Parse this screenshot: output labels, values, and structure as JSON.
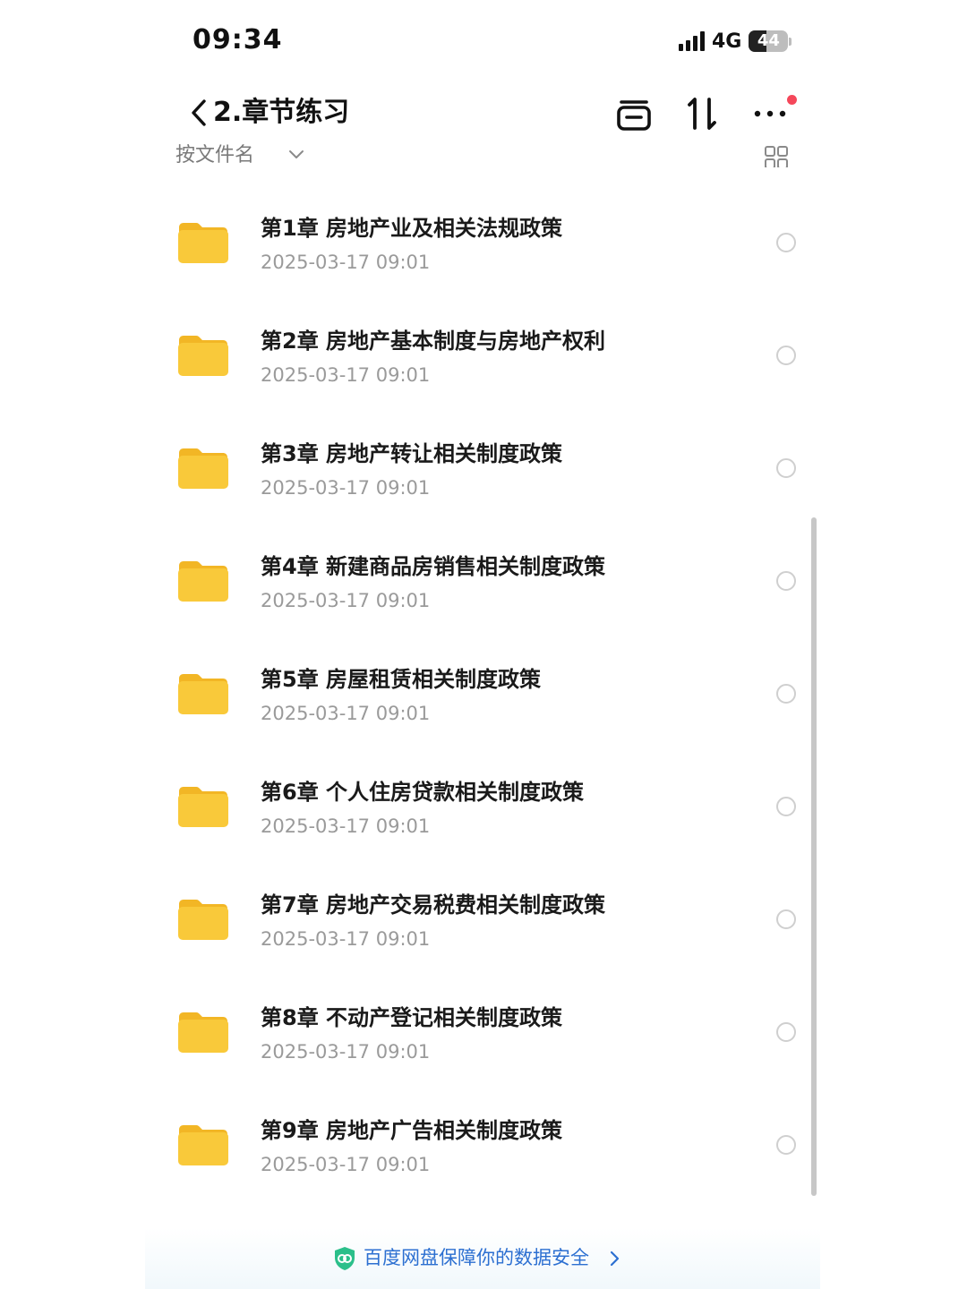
{
  "status_bar": {
    "time": "09:34",
    "network": "4G",
    "battery_level": "44",
    "battery_fraction": 0.44,
    "icons": [
      "signal-icon",
      "battery-icon"
    ]
  },
  "nav": {
    "title": "2.章节练习",
    "icons": [
      "back-chevron-icon",
      "dropbox-icon",
      "sort-icon",
      "more-icon"
    ],
    "notification_dot_color": "#f5475a"
  },
  "toolbar": {
    "sort_label": "按文件名",
    "icons": [
      "chevron-down-icon",
      "grid-view-icon"
    ]
  },
  "files": [
    {
      "name": "第1章 房地产业及相关法规政策",
      "date": "2025-03-17 09:01"
    },
    {
      "name": "第2章 房地产基本制度与房地产权利",
      "date": "2025-03-17 09:01"
    },
    {
      "name": "第3章 房地产转让相关制度政策",
      "date": "2025-03-17 09:01"
    },
    {
      "name": "第4章 新建商品房销售相关制度政策",
      "date": "2025-03-17 09:01"
    },
    {
      "name": "第5章 房屋租赁相关制度政策",
      "date": "2025-03-17 09:01"
    },
    {
      "name": "第6章 个人住房贷款相关制度政策",
      "date": "2025-03-17 09:01"
    },
    {
      "name": "第7章 房地产交易税费相关制度政策",
      "date": "2025-03-17 09:01"
    },
    {
      "name": "第8章 不动产登记相关制度政策",
      "date": "2025-03-17 09:01"
    },
    {
      "name": "第9章 房地产广告相关制度政策",
      "date": "2025-03-17 09:01"
    }
  ],
  "banner": {
    "text": "百度网盘保障你的数据安全",
    "link_color": "#2c6fd1",
    "icons": [
      "security-shield-icon",
      "chevron-right-icon"
    ]
  },
  "colors": {
    "folder": "#f9c93a",
    "folder_tab": "#f2b625",
    "text_primary": "#1a1a1a",
    "text_secondary": "#9a9a9a"
  }
}
